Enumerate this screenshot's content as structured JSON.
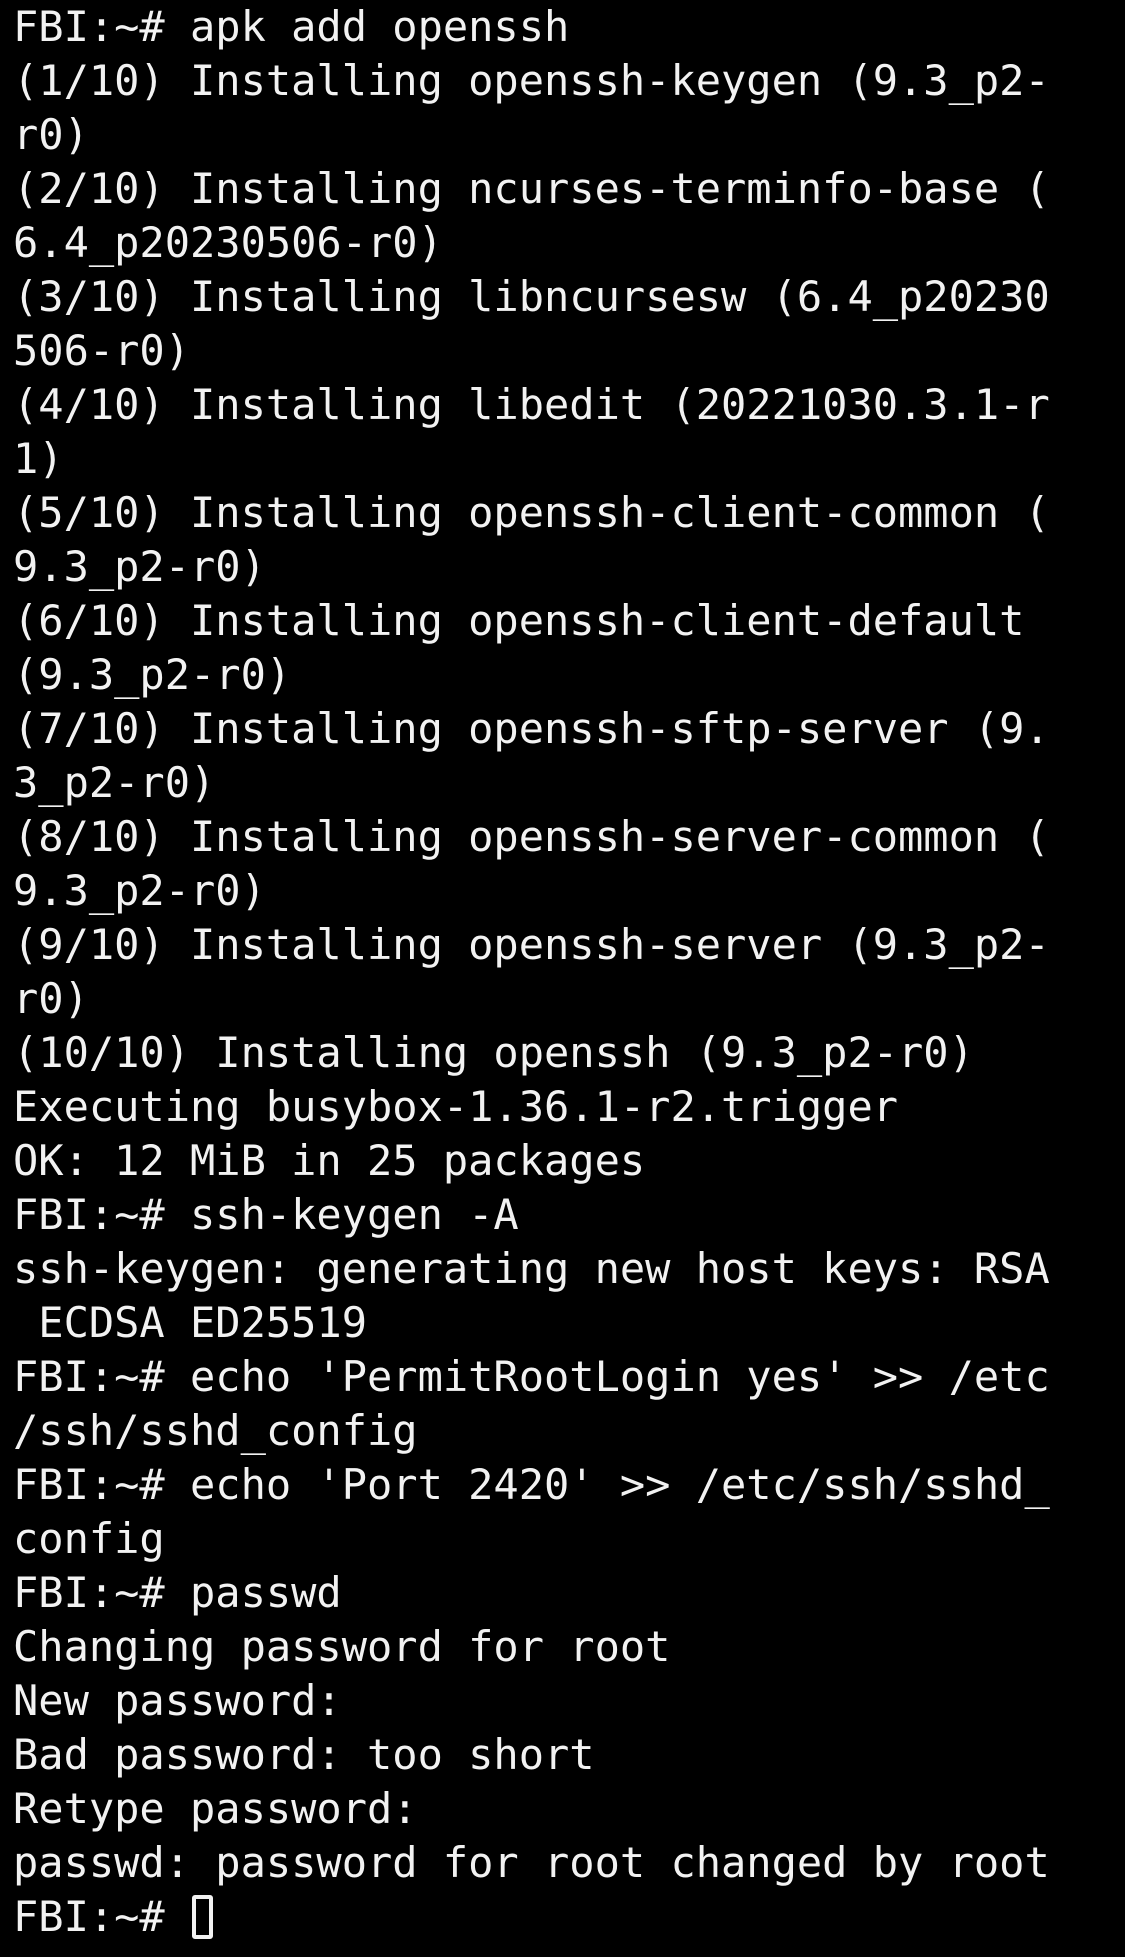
{
  "terminal": {
    "lines": [
      "FBI:~# apk add openssh",
      "(1/10) Installing openssh-keygen (9.3_p2-",
      "r0)",
      "(2/10) Installing ncurses-terminfo-base (",
      "6.4_p20230506-r0)",
      "(3/10) Installing libncursesw (6.4_p20230",
      "506-r0)",
      "(4/10) Installing libedit (20221030.3.1-r",
      "1)",
      "(5/10) Installing openssh-client-common (",
      "9.3_p2-r0)",
      "(6/10) Installing openssh-client-default",
      "(9.3_p2-r0)",
      "(7/10) Installing openssh-sftp-server (9.",
      "3_p2-r0)",
      "(8/10) Installing openssh-server-common (",
      "9.3_p2-r0)",
      "(9/10) Installing openssh-server (9.3_p2-",
      "r0)",
      "(10/10) Installing openssh (9.3_p2-r0)",
      "Executing busybox-1.36.1-r2.trigger",
      "OK: 12 MiB in 25 packages",
      "FBI:~# ssh-keygen -A",
      "ssh-keygen: generating new host keys: RSA",
      " ECDSA ED25519",
      "FBI:~# echo 'PermitRootLogin yes' >> /etc",
      "/ssh/sshd_config",
      "FBI:~# echo 'Port 2420' >> /etc/ssh/sshd_",
      "config",
      "FBI:~# passwd",
      "Changing password for root",
      "New password:",
      "Bad password: too short",
      "Retype password:",
      "passwd: password for root changed by root"
    ],
    "prompt": "FBI:~# "
  }
}
